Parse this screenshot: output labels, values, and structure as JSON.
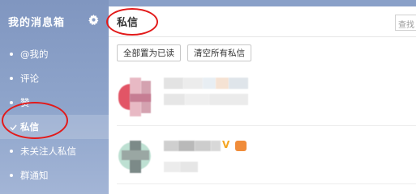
{
  "sidebar": {
    "title": "我的消息箱",
    "items": [
      {
        "label": "@我的"
      },
      {
        "label": "评论"
      },
      {
        "label": "赞"
      },
      {
        "label": "私信"
      },
      {
        "label": "未关注人私信"
      },
      {
        "label": "群通知"
      }
    ]
  },
  "main": {
    "title": "私信",
    "search_placeholder": "查找",
    "buttons": {
      "mark_all_read": "全部置为已读",
      "clear_all": "清空所有私信"
    },
    "messages": [
      {
        "name": "",
        "preview": ""
      },
      {
        "name": "",
        "preview": "",
        "badge": "V"
      }
    ]
  },
  "colors": {
    "sidebar": "#8a9fc6",
    "annotation": "#e21a1a",
    "verified": "#f5a623"
  }
}
